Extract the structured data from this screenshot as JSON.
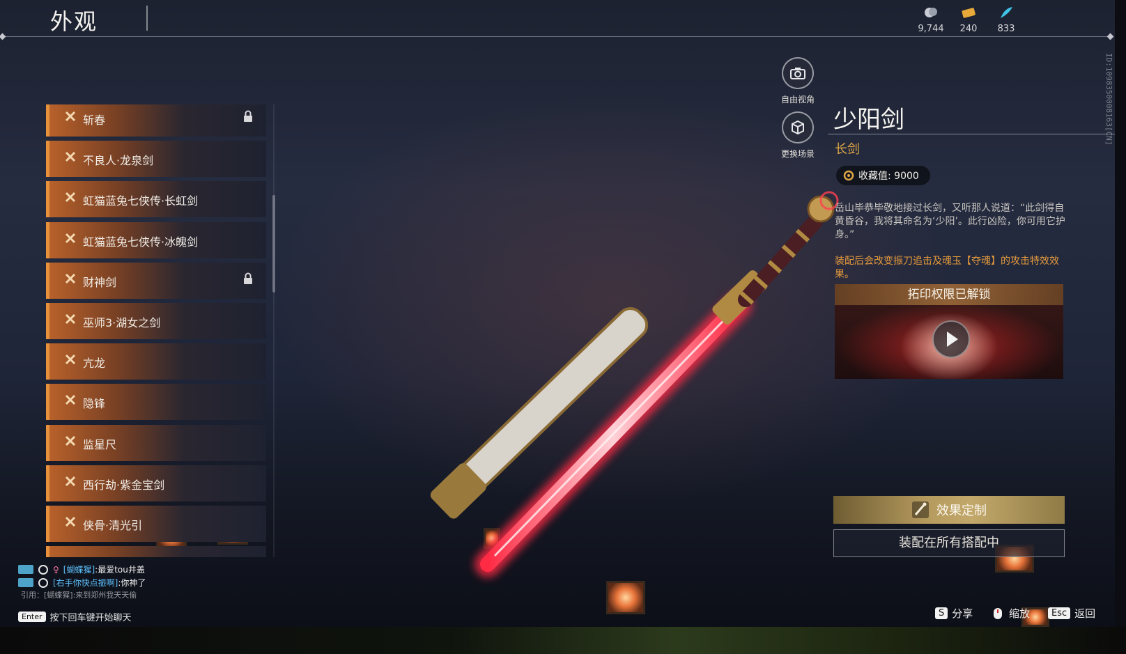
{
  "header": {
    "title": "外观"
  },
  "currencies": [
    {
      "icon": "silver-coin-icon",
      "value": "9,744"
    },
    {
      "icon": "gold-ticket-icon",
      "value": "240"
    },
    {
      "icon": "feather-icon",
      "value": "833"
    }
  ],
  "side_id": "ID:1098350008163[CN]",
  "list": {
    "items": [
      {
        "label": "斩春",
        "locked": true
      },
      {
        "label": "不良人·龙泉剑",
        "locked": false
      },
      {
        "label": "虹猫蓝兔七侠传·长虹剑",
        "locked": false
      },
      {
        "label": "虹猫蓝兔七侠传·冰魄剑",
        "locked": false
      },
      {
        "label": "财神剑",
        "locked": true
      },
      {
        "label": "巫师3·湖女之剑",
        "locked": false
      },
      {
        "label": "亢龙",
        "locked": false
      },
      {
        "label": "隐锋",
        "locked": false
      },
      {
        "label": "监星尺",
        "locked": false
      },
      {
        "label": "西行劫·紫金宝剑",
        "locked": false
      },
      {
        "label": "侠骨·清光引",
        "locked": false
      }
    ]
  },
  "camera": {
    "free_view": "自由视角",
    "change_scene": "更换场景"
  },
  "item": {
    "name": "少阳剑",
    "type": "长剑",
    "collection_label": "收藏值: 9000",
    "description": "岳山毕恭毕敬地接过长剑，又听那人说道：“此剑得自黄昏谷，我将其命名为‘少阳’。此行凶险，你可用它护身。”",
    "effect_note": "装配后会改变振刀追击及魂玉【夺魂】的攻击特效效果。",
    "video_title": "拓印权限已解锁",
    "customize_label": "效果定制",
    "equip_label": "装配在所有搭配中"
  },
  "chat": {
    "messages": [
      {
        "name": "[蝴蝶猩]",
        "text": ":最爱tou井盖"
      },
      {
        "name": "[右手你快点振啊]",
        "text": ":你神了"
      }
    ],
    "quote": "引用：[蝴蝶猩]:来到郑州我天天偷",
    "enter_key": "Enter",
    "hint": "按下回车键开始聊天"
  },
  "hints": {
    "share_key": "S",
    "share_label": "分享",
    "zoom_label": "缩放",
    "esc_key": "Esc",
    "back_label": "返回"
  },
  "colors": {
    "accent_orange": "#e8913c",
    "gold": "#e0a646",
    "blade_red": "#ff3b4e"
  }
}
